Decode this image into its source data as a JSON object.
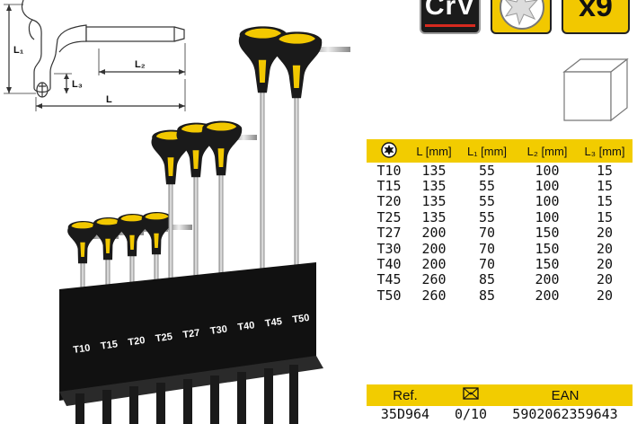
{
  "badges": {
    "material": "CrV",
    "count": "x9"
  },
  "diagram": {
    "l1": "L₁",
    "l2": "L₂",
    "l3": "L₃",
    "l": "L"
  },
  "stand_labels": [
    "T10",
    "T15",
    "T20",
    "T25",
    "T27",
    "T30",
    "T40",
    "T45",
    "T50"
  ],
  "spec_table": {
    "icon": "torx-icon",
    "headers": [
      "L [mm]",
      "L₁ [mm]",
      "L₂ [mm]",
      "L₃ [mm]"
    ],
    "rows": [
      [
        "T10",
        "135",
        "55",
        "100",
        "15"
      ],
      [
        "T15",
        "135",
        "55",
        "100",
        "15"
      ],
      [
        "T20",
        "135",
        "55",
        "100",
        "15"
      ],
      [
        "T25",
        "135",
        "55",
        "100",
        "15"
      ],
      [
        "T27",
        "200",
        "70",
        "150",
        "20"
      ],
      [
        "T30",
        "200",
        "70",
        "150",
        "20"
      ],
      [
        "T40",
        "200",
        "70",
        "150",
        "20"
      ],
      [
        "T45",
        "260",
        "85",
        "200",
        "20"
      ],
      [
        "T50",
        "260",
        "85",
        "200",
        "20"
      ]
    ]
  },
  "ref_table": {
    "headers": [
      "Ref.",
      "EAN"
    ],
    "package_icon": "package-icon",
    "row": [
      "35D964",
      "0/10",
      "5902062359643"
    ]
  },
  "colors": {
    "accent_yellow": "#f2cc00",
    "handle_black": "#1a1a1a",
    "crv_red": "#d72a1f"
  }
}
